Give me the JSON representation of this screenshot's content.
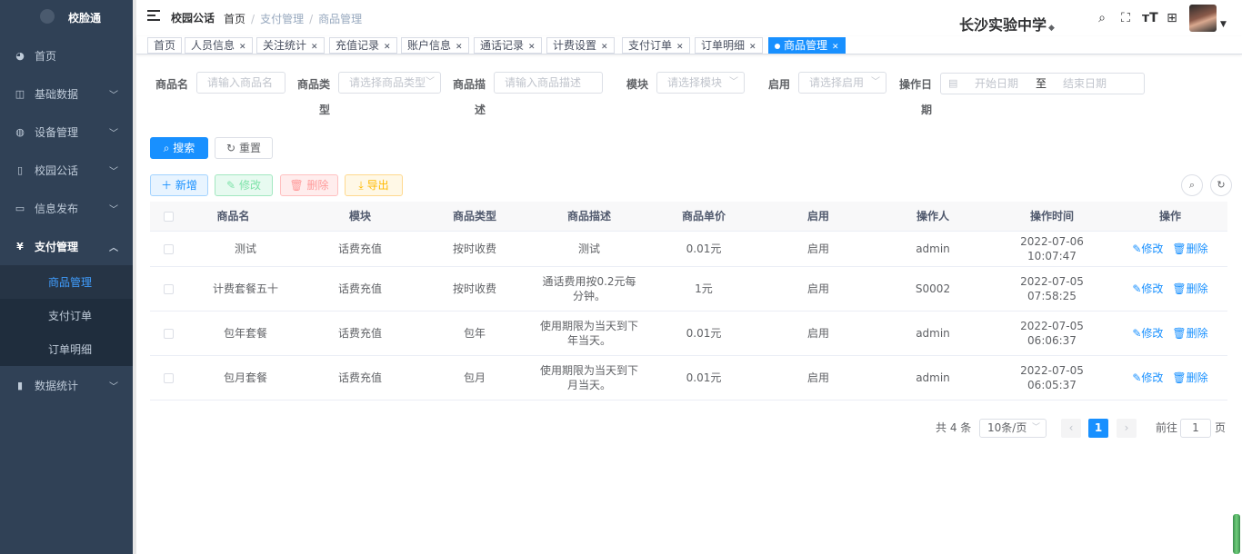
{
  "app": {
    "name": "校脸通"
  },
  "sidebar": {
    "items": [
      {
        "label": "首页",
        "icon": "dashboard-icon"
      },
      {
        "label": "基础数据",
        "icon": "table-icon"
      },
      {
        "label": "设备管理",
        "icon": "globe-icon"
      },
      {
        "label": "校园公话",
        "icon": "phone-icon"
      },
      {
        "label": "信息发布",
        "icon": "monitor-icon"
      },
      {
        "label": "支付管理",
        "icon": "yen-icon"
      },
      {
        "label": "数据统计",
        "icon": "bar-chart-icon"
      }
    ],
    "submenu": [
      {
        "label": "商品管理",
        "active": true
      },
      {
        "label": "支付订单"
      },
      {
        "label": "订单明细"
      }
    ]
  },
  "header": {
    "section": "校园公话",
    "breadcrumb": [
      "首页",
      "支付管理",
      "商品管理"
    ],
    "school": "长沙实验中学"
  },
  "tags": [
    {
      "label": "首页"
    },
    {
      "label": "人员信息"
    },
    {
      "label": "关注统计"
    },
    {
      "label": "充值记录"
    },
    {
      "label": "账户信息"
    },
    {
      "label": "通话记录"
    },
    {
      "label": "计费设置"
    },
    {
      "label": "支付订单"
    },
    {
      "label": "订单明细"
    },
    {
      "label": "商品管理",
      "active": true
    }
  ],
  "filters": {
    "name_label": "商品名",
    "name_placeholder": "请输入商品名",
    "type_label_1": "商品类",
    "type_label_2": "型",
    "type_placeholder": "请选择商品类型",
    "desc_label_1": "商品描",
    "desc_label_2": "述",
    "desc_placeholder": "请输入商品描述",
    "module_label": "模块",
    "module_placeholder": "请选择模块",
    "enabled_label": "启用",
    "enabled_placeholder": "请选择启用",
    "date_label_1": "操作日",
    "date_label_2": "期",
    "date_start": "开始日期",
    "date_to": "至",
    "date_end": "结束日期"
  },
  "toolbar": {
    "search": "搜索",
    "reset": "重置",
    "add": "新增",
    "edit": "修改",
    "delete": "删除",
    "export": "导出"
  },
  "table": {
    "columns": [
      "商品名",
      "模块",
      "商品类型",
      "商品描述",
      "商品单价",
      "启用",
      "操作人",
      "操作时间",
      "操作"
    ],
    "rows": [
      {
        "name": "测试",
        "module": "话费充值",
        "type": "按时收费",
        "desc": "测试",
        "price": "0.01元",
        "enabled": "启用",
        "operator": "admin",
        "time": "2022-07-06 10:07:47"
      },
      {
        "name": "计费套餐五十",
        "module": "话费充值",
        "type": "按时收费",
        "desc": "通话费用按0.2元每分钟。",
        "price": "1元",
        "enabled": "启用",
        "operator": "S0002",
        "time": "2022-07-05 07:58:25"
      },
      {
        "name": "包年套餐",
        "module": "话费充值",
        "type": "包年",
        "desc": "使用期限为当天到下年当天。",
        "price": "0.01元",
        "enabled": "启用",
        "operator": "admin",
        "time": "2022-07-05 06:06:37"
      },
      {
        "name": "包月套餐",
        "module": "话费充值",
        "type": "包月",
        "desc": "使用期限为当天到下月当天。",
        "price": "0.01元",
        "enabled": "启用",
        "operator": "admin",
        "time": "2022-07-05 06:05:37"
      }
    ],
    "row_edit": "修改",
    "row_delete": "删除"
  },
  "pagination": {
    "total": "共 4 条",
    "page_size": "10条/页",
    "current": "1",
    "goto_label": "前往",
    "goto_value": "1",
    "page_suffix": "页"
  },
  "colors": {
    "primary": "#1890ff",
    "sidebar": "#304156",
    "submenu": "#1f2d3d"
  }
}
